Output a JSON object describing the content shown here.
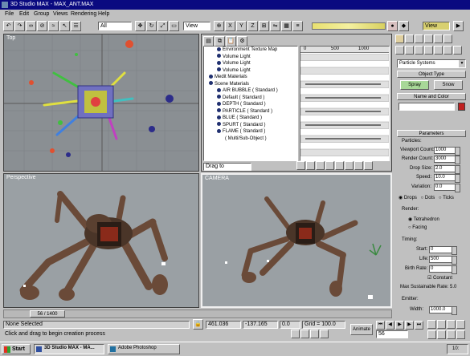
{
  "window": {
    "title": "3D Studio MAX - MAX_ANT.MAX"
  },
  "menu": [
    "File",
    "Edit",
    "Group",
    "Views",
    "Rendering",
    "Help"
  ],
  "toolbar": {
    "selection_filter": "All",
    "view_dropdown": "View"
  },
  "viewports": {
    "top": "Top",
    "perspective": "Perspective",
    "camera": "CAMERA"
  },
  "trackview": {
    "items": [
      "Environment Texture Map",
      "Volume Light",
      "Volume Light",
      "Volume Light",
      "Medit Materials",
      "Scene Materials",
      "AIR BUBBLE ( Standard )",
      "Default ( Standard )",
      "DEPTH ( Standard )",
      "PARTICLE ( Standard )",
      "BLUE ( Standard )",
      "SPURT ( Standard )",
      "FLAME ( Standard )",
      "( Multi/Sub-Object )"
    ],
    "ruler": [
      "0",
      "500",
      "1000"
    ],
    "status": "Drag to"
  },
  "command_panel": {
    "category": "Particle Systems",
    "object_type_header": "Object Type",
    "buttons": [
      "Spray",
      "Snow"
    ],
    "name_color_header": "Name and Color",
    "parameters_header": "Parameters",
    "particles_label": "Particles:",
    "fields": [
      {
        "label": "Viewport Count:",
        "value": "1000"
      },
      {
        "label": "Render Count:",
        "value": "3000"
      },
      {
        "label": "Drop Size:",
        "value": "2.0"
      },
      {
        "label": "Speed:",
        "value": "10.0"
      },
      {
        "label": "Variation:",
        "value": "0.0"
      }
    ],
    "drop_types": [
      "Drops",
      "Dots",
      "Ticks"
    ],
    "render_label": "Render:",
    "render_options": [
      "Tetrahedron",
      "Facing"
    ],
    "timing_label": "Timing:",
    "timing": [
      {
        "label": "Start:",
        "value": "0"
      },
      {
        "label": "Life:",
        "value": "500"
      },
      {
        "label": "Birth Rate:",
        "value": "0"
      }
    ],
    "constant_label": "Constant",
    "max_rate": "Max Sustainable Rate: 5.0",
    "emitter_label": "Emitter:",
    "width_label": "Width:",
    "width_value": "1000.0"
  },
  "timeline": {
    "frame": "56 / 1400"
  },
  "status": {
    "selection": "None Selected",
    "prompt": "Click and drag to begin creation process",
    "x": "461.036",
    "y": "-137.165",
    "z": "0.0",
    "grid": "Grid = 100.0",
    "animate": "Animate",
    "frame_field": "56"
  },
  "taskbar": {
    "start": "Start",
    "tasks": [
      "3D Studio MAX - MA...",
      "Adobe Photoshop"
    ],
    "clock": "10:"
  },
  "colors": {
    "desktop_bar": "#0a0a80",
    "viewport_bg": "#8a8f93",
    "ui_gray": "#c0c0c0"
  }
}
